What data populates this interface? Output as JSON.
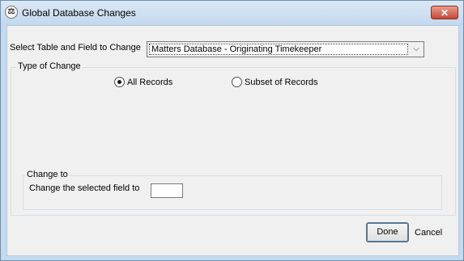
{
  "window": {
    "title": "Global Database Changes",
    "close_glyph": "✕",
    "icon": "app-logo-icon"
  },
  "selector": {
    "label": "Select Table and Field to Change",
    "value": "Matters Database - Originating Timekeeper",
    "arrow_glyph": "⌵"
  },
  "type_of_change": {
    "title": "Type of Change",
    "options": [
      {
        "label": "All Records",
        "selected": true
      },
      {
        "label": "Subset of Records",
        "selected": false
      }
    ]
  },
  "change_to": {
    "title": "Change to",
    "field_label": "Change the selected field to",
    "field_value": ""
  },
  "buttons": {
    "done": "Done",
    "cancel": "Cancel"
  }
}
